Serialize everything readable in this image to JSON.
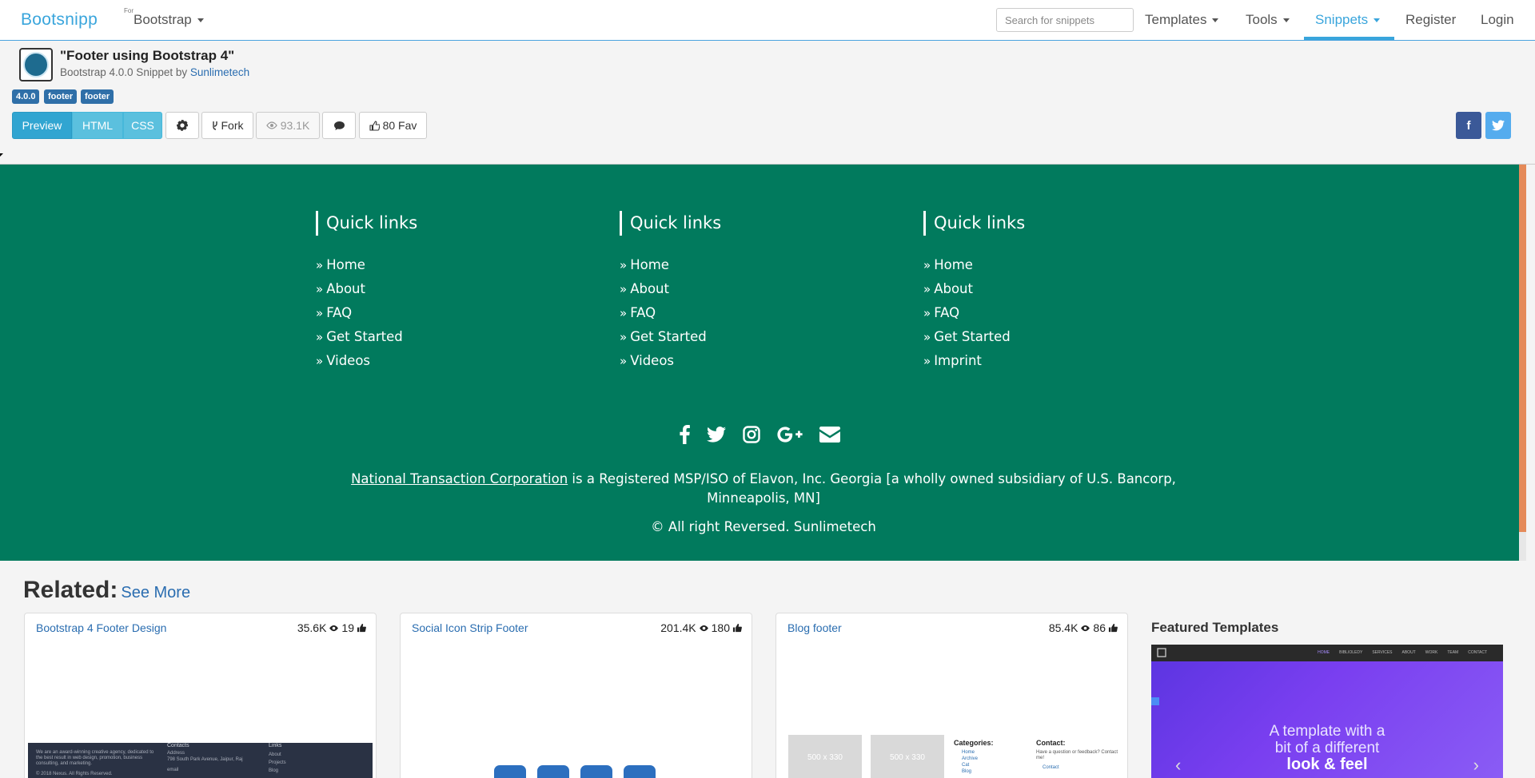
{
  "navbar": {
    "brand": "Bootsnipp",
    "for_label": "For",
    "framework": "Bootstrap",
    "search_placeholder": "Search for snippets",
    "items": [
      {
        "label": "Templates",
        "dropdown": true
      },
      {
        "label": "Tools",
        "dropdown": true
      },
      {
        "label": "Snippets",
        "dropdown": true,
        "active": true
      },
      {
        "label": "Register",
        "dropdown": false
      },
      {
        "label": "Login",
        "dropdown": false
      }
    ]
  },
  "snippet": {
    "title": "\"Footer using Bootstrap 4\"",
    "subtitle_prefix": "Bootstrap 4.0.0 Snippet by",
    "author": "Sunlimetech",
    "tags": [
      "4.0.0",
      "footer",
      "footer"
    ],
    "view_tabs": [
      "Preview",
      "HTML",
      "CSS"
    ],
    "fork_label": "Fork",
    "views": "93.1K",
    "fav_label": "80 Fav",
    "share": [
      "f",
      "t"
    ]
  },
  "footer": {
    "columns": [
      {
        "title": "Quick links",
        "links": [
          "Home",
          "About",
          "FAQ",
          "Get Started",
          "Videos"
        ]
      },
      {
        "title": "Quick links",
        "links": [
          "Home",
          "About",
          "FAQ",
          "Get Started",
          "Videos"
        ]
      },
      {
        "title": "Quick links",
        "links": [
          "Home",
          "About",
          "FAQ",
          "Get Started",
          "Imprint"
        ]
      }
    ],
    "link_prefix": "»",
    "company_link": "National Transaction Corporation",
    "legal_text": " is a Registered MSP/ISO of Elavon, Inc. Georgia [a wholly owned subsidiary of U.S. Bancorp, Minneapolis, MN]",
    "copyright": "© All right Reversed.  Sunlimetech",
    "social_icons": [
      "facebook-icon",
      "twitter-icon",
      "instagram-icon",
      "google-plus-icon",
      "envelope-icon"
    ]
  },
  "related": {
    "heading": "Related:",
    "see_more": "See More",
    "cards": [
      {
        "title": "Bootstrap 4 Footer Design",
        "views": "35.6K",
        "likes": "19"
      },
      {
        "title": "Social Icon Strip Footer",
        "views": "201.4K",
        "likes": "180"
      },
      {
        "title": "Blog footer",
        "views": "85.4K",
        "likes": "86"
      }
    ],
    "card1_thumb": {
      "intro": "We are an award-winning creative agency, dedicated to the best result in web design, promotion, business consulting, and marketing.",
      "copyright": "© 2018 Nexus. All Rights Reserved.",
      "contacts_h": "Contacts",
      "address_l": "Address",
      "address": "798 South Park Avenue, Jaipur, Raj",
      "email_l": "email",
      "links_h": "Links",
      "links": [
        "About",
        "Projects",
        "Blog"
      ]
    },
    "card3_thumb": {
      "placeholder": "500 x 330",
      "categories_h": "Categories:",
      "categories": [
        "Home",
        "Archive",
        "Cat",
        "Blog"
      ],
      "contact_h": "Contact:",
      "contact_text": "Have a question or feedback? Contact me!",
      "contact_link": "Contact"
    }
  },
  "featured": {
    "heading": "Featured Templates",
    "line1": "A template with a",
    "line2": "bit of a different",
    "line3": "look & feel",
    "nav": [
      "HOME",
      "BIBLIOLEDY",
      "SERVICES",
      "ABOUT",
      "WORK",
      "TEAM",
      "CONTACT"
    ]
  },
  "colors": {
    "accent": "#39a5dc",
    "footer_bg": "#017a5d",
    "tag_bg": "#2f6fa8",
    "preview_btn": "#31a5d1",
    "facebook": "#3b5998",
    "twitter": "#55acee"
  }
}
